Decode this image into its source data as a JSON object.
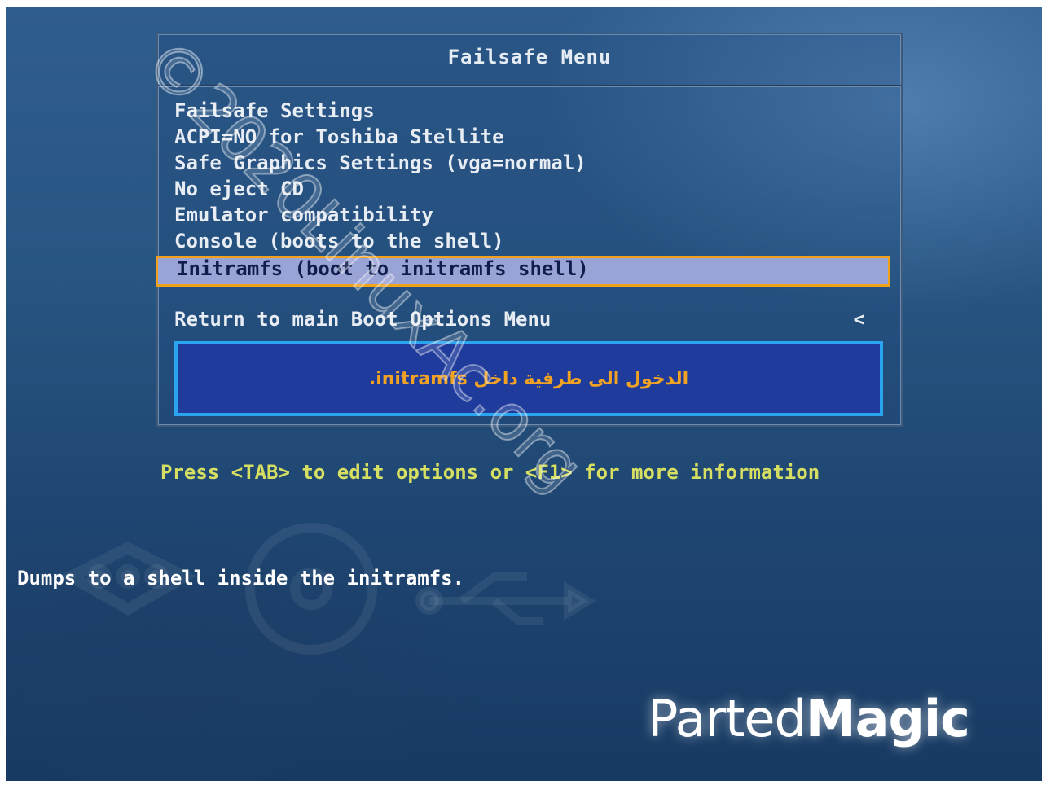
{
  "menu": {
    "title": "Failsafe Menu",
    "items": [
      {
        "label": "Failsafe Settings"
      },
      {
        "label": "ACPI=NO for Toshiba Stellite"
      },
      {
        "label": "Safe Graphics Settings (vga=normal)"
      },
      {
        "label": "No eject CD"
      },
      {
        "label": "Emulator compatibility"
      },
      {
        "label": "Console (boots to the shell)"
      },
      {
        "label": "Initramfs (boot to initramfs shell)",
        "selected": true
      }
    ],
    "return_item": {
      "label": "Return to main Boot Options Menu",
      "arrow": "<"
    }
  },
  "help_box": {
    "text": "الدخول الى طرفية داخل initramfs."
  },
  "press_hint": "Press <TAB> to edit options or <F1> for more information",
  "description": "Dumps to a shell inside the initramfs.",
  "watermark": "©2020LinuxAc.org",
  "logo": {
    "light": "Parted",
    "bold": "Magic"
  },
  "colors": {
    "selection_bg": "#9aa3d6",
    "selection_border": "#f2a21a",
    "help_border": "#2aa4ef",
    "help_bg": "#1f3b9c",
    "help_text": "#f0a225",
    "hint_text": "#d6df62"
  },
  "background_icons": [
    "network-icon",
    "disc-icon",
    "usb-icon"
  ]
}
